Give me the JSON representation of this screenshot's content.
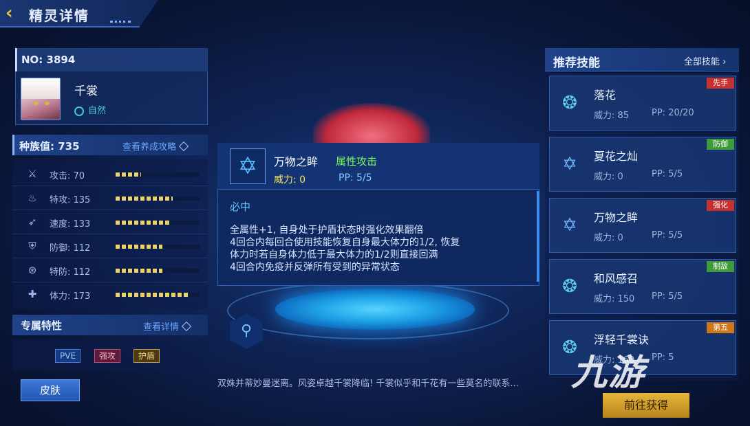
{
  "header": {
    "title": "精灵详情"
  },
  "spirit": {
    "number": "NO: 3894",
    "name": "千裳",
    "type": "自然"
  },
  "race": {
    "label": "种族值: 735",
    "link": "查看养成攻略"
  },
  "stats": [
    {
      "label": "攻击: 70",
      "value": 70
    },
    {
      "label": "特攻: 135",
      "value": 135
    },
    {
      "label": "速度: 133",
      "value": 133
    },
    {
      "label": "防御: 112",
      "value": 112
    },
    {
      "label": "特防: 112",
      "value": 112
    },
    {
      "label": "体力: 173",
      "value": 173
    }
  ],
  "trait": {
    "title": "专属特性",
    "link": "查看详情",
    "tags": [
      "PVE",
      "强攻",
      "护盾"
    ]
  },
  "buttons": {
    "skin": "皮肤",
    "go": "前往获得"
  },
  "popup": {
    "name": "万物之眸",
    "type": "属性攻击",
    "power": "威力: 0",
    "pp": "PP: 5/5",
    "subtitle": "必中",
    "desc": [
      "全属性+1, 自身处于护盾状态时强化效果翻倍",
      "4回合内每回合使用技能恢复自身最大体力的1/2, 恢复",
      "体力时若自身体力低于最大体力的1/2则直接回满",
      "4回合内免疫并反弹所有受到的异常状态"
    ]
  },
  "flavor": "双姝并蒂妙曼迷离。风姿卓越千裳降临! 千裳似乎和千花有一些莫名的联系...",
  "skills_panel": {
    "title": "推荐技能",
    "all": "全部技能"
  },
  "skills": [
    {
      "name": "落花",
      "power": "威力: 85",
      "pp": "PP: 20/20",
      "tag": "先手",
      "icon": "swirl-icon"
    },
    {
      "name": "夏花之灿",
      "power": "威力: 0",
      "pp": "PP: 5/5",
      "tag": "防御",
      "icon": "star-icon"
    },
    {
      "name": "万物之眸",
      "power": "威力: 0",
      "pp": "PP: 5/5",
      "tag": "强化",
      "icon": "star-icon"
    },
    {
      "name": "和风感召",
      "power": "威力: 150",
      "pp": "PP: 5/5",
      "tag": "制敌",
      "icon": "swirl-icon"
    },
    {
      "name": "浮轻千裳诀",
      "power": "威力: 160",
      "pp": "PP: 5",
      "tag": "第五",
      "icon": "swirl-icon"
    }
  ],
  "watermark": "九游",
  "colors": {
    "accent": "#f0c23a",
    "panel": "#143068",
    "skill_type": "#7cfa5c",
    "power": "#f3e25c"
  }
}
